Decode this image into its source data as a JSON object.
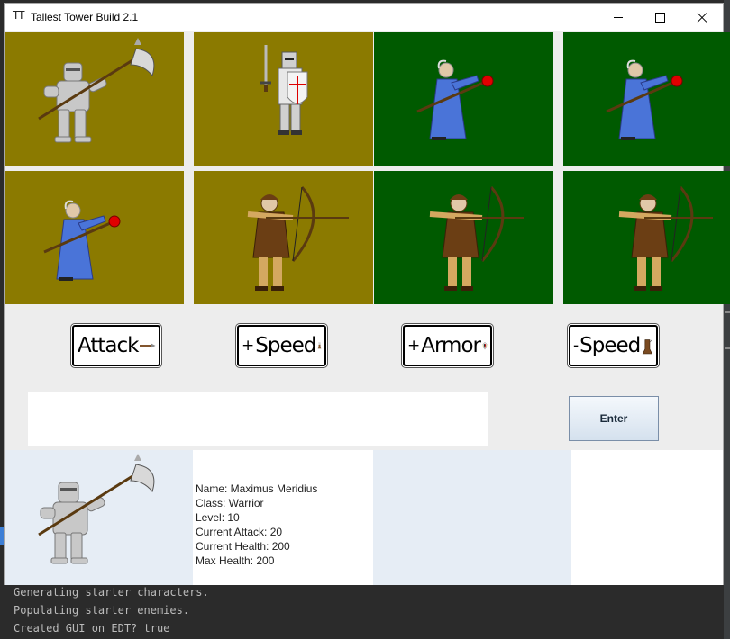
{
  "window": {
    "title": "Tallest Tower Build 2.1",
    "icon_glyph": "TT",
    "controls": [
      "minimize-icon",
      "maximize-icon",
      "close-icon"
    ]
  },
  "party_grid": [
    {
      "slot": 1,
      "character": "knight-with-halberd",
      "team": "player",
      "color": "#8b7a00"
    },
    {
      "slot": 2,
      "character": "crusader-with-shield",
      "team": "player",
      "color": "#8b7a00"
    },
    {
      "slot": 3,
      "character": "blue-wizard",
      "team": "enemy",
      "color": "#005a00"
    },
    {
      "slot": 4,
      "character": "blue-wizard",
      "team": "enemy",
      "color": "#005a00"
    },
    {
      "slot": 5,
      "character": "blue-wizard",
      "team": "player",
      "color": "#8b7a00"
    },
    {
      "slot": 6,
      "character": "archer",
      "team": "player",
      "color": "#8b7a00"
    },
    {
      "slot": 7,
      "character": "archer",
      "team": "enemy",
      "color": "#005a00"
    },
    {
      "slot": 8,
      "character": "archer",
      "team": "enemy",
      "color": "#005a00"
    }
  ],
  "actions": {
    "attack": {
      "prefix": "",
      "label": "Attack",
      "icon": "spear-icon"
    },
    "speed_up": {
      "prefix": "+",
      "label": "Speed",
      "icon": "boot-wing-icon"
    },
    "armor": {
      "prefix": "+",
      "label": "Armor",
      "icon": "shield-icon"
    },
    "speed_down": {
      "prefix": "-",
      "label": "Speed",
      "icon": "boot-icon"
    }
  },
  "input": {
    "value": ""
  },
  "enter_label": "Enter",
  "selected_character": {
    "name": "Name: Maximus Meridius",
    "class": "Class: Warrior",
    "level": "Level: 10",
    "current_attack": "Current Attack: 20",
    "current_health": "Current Health: 200",
    "max_health": "Max Health: 200"
  },
  "console": [
    "Generating starter characters.",
    "Populating starter enemies.",
    "Created GUI on EDT? true"
  ],
  "colors": {
    "player_tile": "#8b7a00",
    "enemy_tile": "#005a00",
    "window_bg": "#ededed",
    "console_bg": "#2b2b2b"
  }
}
